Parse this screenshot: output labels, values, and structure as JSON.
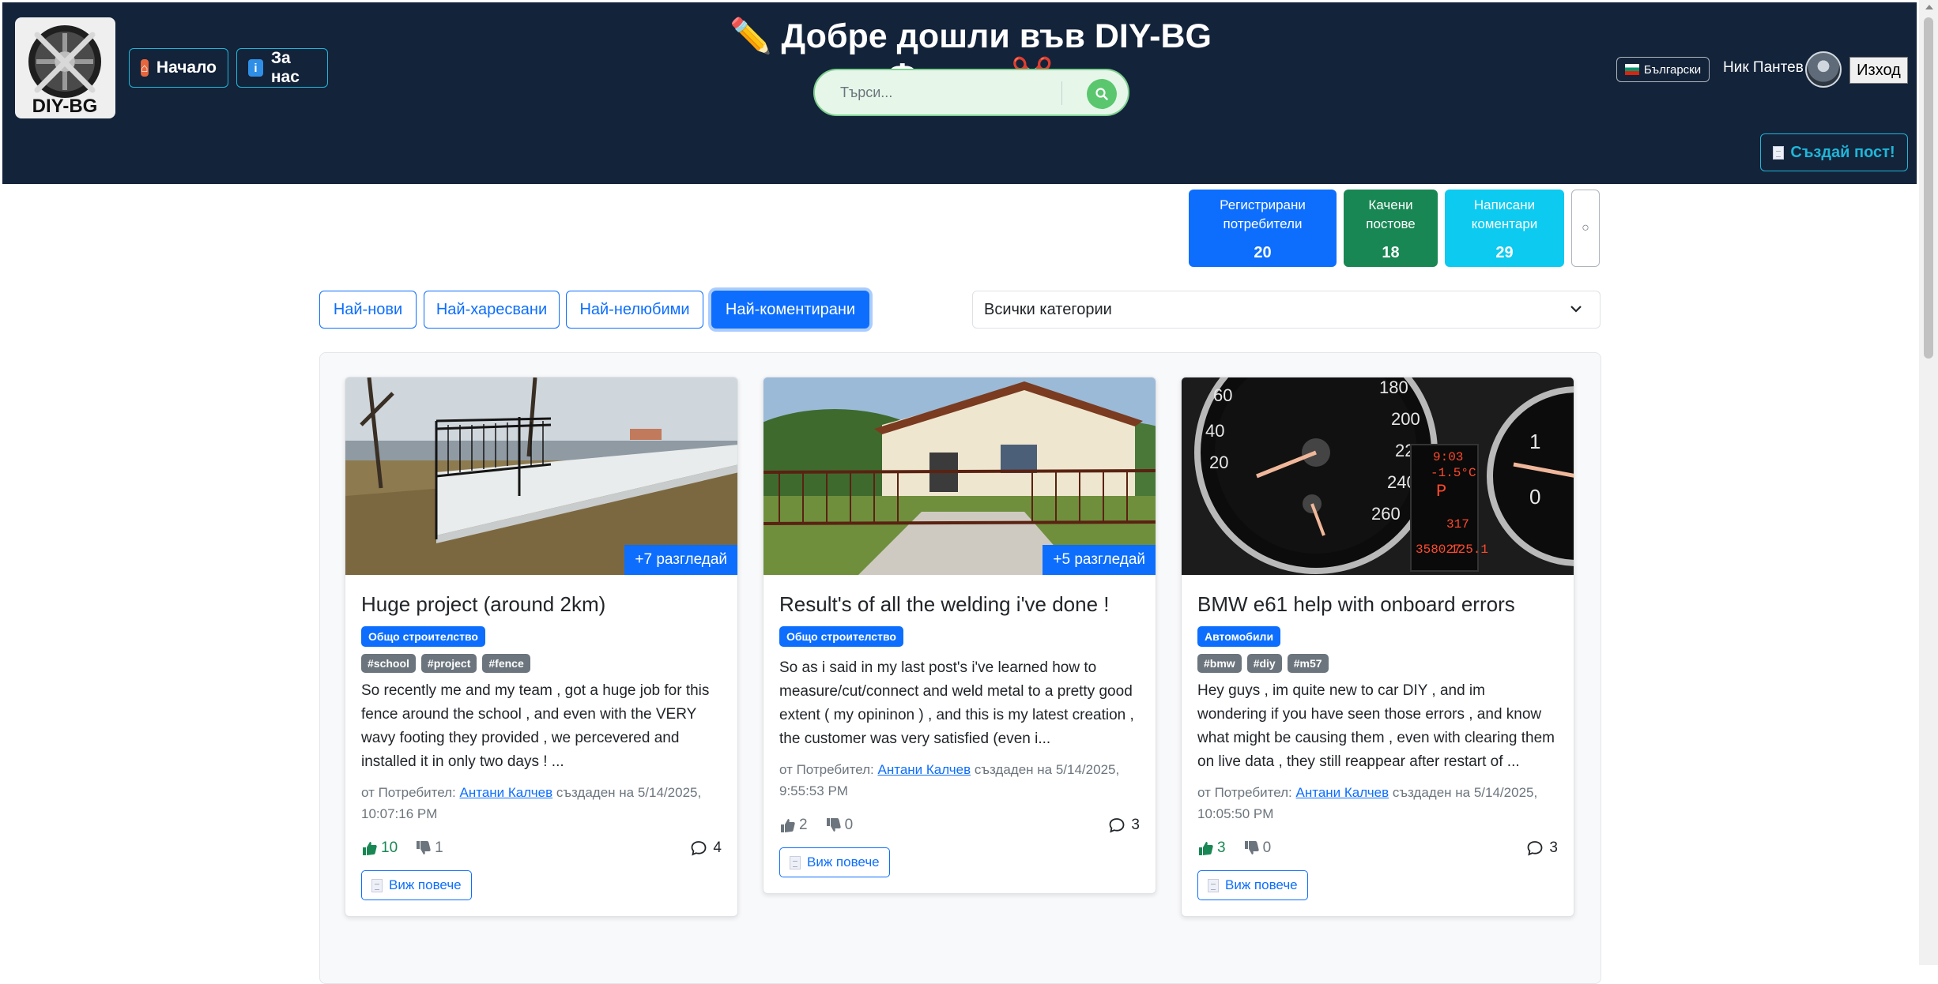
{
  "header": {
    "logo_text": "DIY-BG",
    "nav": [
      {
        "label": "Начало",
        "icon": "house-icon"
      },
      {
        "label": "За нас",
        "icon": "info-icon"
      }
    ],
    "title": "✏️ Добре дошли във DIY-BG Форум ✂️",
    "search_placeholder": "Търси...",
    "language": "Български",
    "user_name": "Ник Пантев",
    "logout_label": "Изход",
    "create_post_label": "Създай пост!"
  },
  "stats": [
    {
      "label": "Регистрирани потребители",
      "value": "20",
      "color": "#0d6efd"
    },
    {
      "label": "Качени постове",
      "value": "18",
      "color": "#198754"
    },
    {
      "label": "Написани коментари",
      "value": "29",
      "color": "#0dcaf0"
    }
  ],
  "filters": {
    "tabs": [
      "Най-нови",
      "Най-харесвани",
      "Най-нелюбими",
      "Най-коментирани"
    ],
    "active": "Най-коментирани",
    "category_selected": "Всички категории"
  },
  "posts": [
    {
      "views_label": "+7 разгледай",
      "title": "Huge project (around 2km)",
      "category": "Общо строителство",
      "tags": [
        "#school",
        "#project",
        "#fence"
      ],
      "description": "So recently me and my team , got a huge job for this fence around the school , and even with the VERY wavy footing they provided , we percevered and installed it in only two days ! ...",
      "meta_prefix": "от Потребител:",
      "author": "Антани Калчев",
      "meta_created": "създаден на 5/14/2025, 10:07:16 PM",
      "likes": "10",
      "dislikes": "1",
      "comments": "4",
      "more_label": "Виж повече"
    },
    {
      "views_label": "+5 разгледай",
      "title": "Result's of all the welding i've done !",
      "category": "Общо строителство",
      "tags": [],
      "description": "So as i said in my last post's i've learned how to measure/cut/connect and weld metal to a pretty good extent ( my opininon ) , and this is my latest creation , the customer was very satisfied (even i...",
      "meta_prefix": "от Потребител:",
      "author": "Антани Калчев",
      "meta_created": "създаден на 5/14/2025, 9:55:53 PM",
      "likes": "2",
      "dislikes": "0",
      "comments": "3",
      "more_label": "Виж повече"
    },
    {
      "views_label": "",
      "title": "BMW e61 help with onboard errors",
      "category": "Автомобили",
      "tags": [
        "#bmw",
        "#diy",
        "#m57"
      ],
      "description": "Hey guys , im quite new to car DIY , and im wondering if you have seen those errors , and know what might be causing them , even with clearing them on live data , they still reappear after restart of ...",
      "meta_prefix": "от Потребител:",
      "author": "Антани Калчев",
      "meta_created": "създаден на 5/14/2025, 10:05:50 PM",
      "likes": "3",
      "dislikes": "0",
      "comments": "3",
      "more_label": "Виж повече"
    }
  ]
}
